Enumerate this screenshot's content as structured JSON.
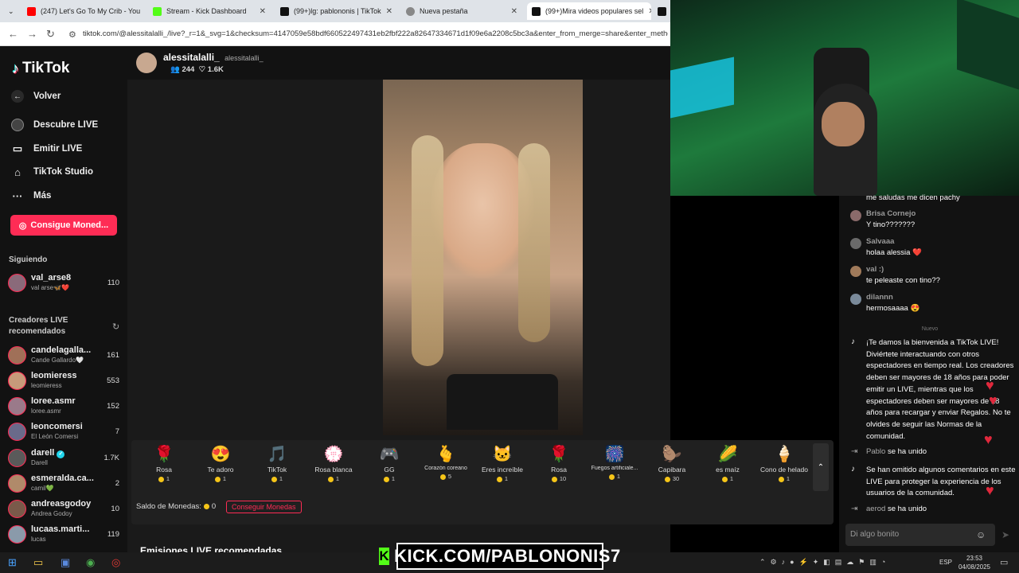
{
  "browser": {
    "tabs": [
      {
        "label": "(247) Let's Go To My Crib - You",
        "favcolor": "#ff0000"
      },
      {
        "label": "Stream - Kick Dashboard",
        "favcolor": "#53fc18"
      },
      {
        "label": "(99+)lg: pablononis | TikTok",
        "favcolor": "#111111"
      },
      {
        "label": "Nueva pestaña",
        "favcolor": "#888888"
      },
      {
        "label": "(99+)Mira videos populares sel",
        "favcolor": "#111111"
      }
    ],
    "url": "tiktok.com/@alessitalalli_/live?_r=1&_svg=1&checksum=4147059e58bdf660522497431eb2fbf222a82647334671d1f09e6a2208c5bc3a&enter_from_merge=share&enter_method=sh"
  },
  "sidebar": {
    "logo": "TikTok",
    "back_label": "Volver",
    "nav": [
      {
        "label": "Descubre LIVE",
        "icon": "live-discover-icon"
      },
      {
        "label": "Emitir LIVE",
        "icon": "broadcast-icon"
      },
      {
        "label": "TikTok Studio",
        "icon": "studio-icon"
      },
      {
        "label": "Más",
        "icon": "more-icon"
      }
    ],
    "coin_button": "Consigue Moned...",
    "following_title": "Siguiendo",
    "following": [
      {
        "name": "val_arse8",
        "sub": "val arse🦋❤️",
        "count": "110",
        "color": "#8a6a7a"
      }
    ],
    "recommended_title": "Creadores LIVE recomendados",
    "recommended": [
      {
        "name": "candelagalla...",
        "sub": "Cande Gallardo🤍",
        "count": "161",
        "color": "#a07058"
      },
      {
        "name": "leomieress",
        "sub": "leomieress",
        "count": "553",
        "color": "#c79a7a"
      },
      {
        "name": "loree.asmr",
        "sub": "loree.asmr",
        "count": "152",
        "color": "#9a7a8a"
      },
      {
        "name": "leoncomersi",
        "sub": "El León Comersi",
        "count": "7",
        "color": "#6a6a8a"
      },
      {
        "name": "darell",
        "sub": "Darell",
        "count": "1.7K",
        "color": "#5a5a5a"
      },
      {
        "name": "esmeralda.ca...",
        "sub": "camil💚",
        "count": "2",
        "color": "#b08a6a"
      },
      {
        "name": "andreasgodoy",
        "sub": "Andrea Godoy",
        "count": "10",
        "color": "#7a5a4a"
      },
      {
        "name": "lucaas.marti...",
        "sub": "lucas",
        "count": "119",
        "color": "#8a9aaa"
      }
    ]
  },
  "live": {
    "username": "alessitalalli_",
    "handle": "alessitalalli_",
    "viewers": "244",
    "likes": "1.6K"
  },
  "gifts": [
    {
      "name": "Rosa",
      "price": "1",
      "icon": "🌹"
    },
    {
      "name": "Te adoro",
      "price": "1",
      "icon": "😍"
    },
    {
      "name": "TikTok",
      "price": "1",
      "icon": "🎵"
    },
    {
      "name": "Rosa blanca",
      "price": "1",
      "icon": "💮"
    },
    {
      "name": "GG",
      "price": "1",
      "icon": "🎮"
    },
    {
      "name": "Corazón coreano",
      "price": "5",
      "icon": "🫰"
    },
    {
      "name": "Eres increíble",
      "price": "1",
      "icon": "🐱"
    },
    {
      "name": "Rosa",
      "price": "10",
      "icon": "🌹"
    },
    {
      "name": "Fuegos artificiale...",
      "price": "1",
      "icon": "🎆"
    },
    {
      "name": "Capibara",
      "price": "30",
      "icon": "🦫"
    },
    {
      "name": "es maíz",
      "price": "1",
      "icon": "🌽"
    },
    {
      "name": "Cono de helado",
      "price": "1",
      "icon": "🍦"
    }
  ],
  "balance": {
    "label": "Saldo de Monedas:",
    "value": "0",
    "button": "Conseguir Monedas"
  },
  "recommended_live_title": "Emisiones LIVE recomendadas",
  "chat": {
    "top_partial": "me saludas me dicen pachy",
    "messages": [
      {
        "name": "Brisa Cornejo",
        "text": "Y tino???????"
      },
      {
        "name": "Salvaaa",
        "text": "holaa alessia ❤️"
      },
      {
        "name": "val :)",
        "text": "te peleaste con tino??"
      },
      {
        "name": "dilannn",
        "text": "hermosaaaa 😍"
      }
    ],
    "divider": "Nuevo",
    "system_welcome": "¡Te damos la bienvenida a TikTok LIVE! Diviértete interactuando con otros espectadores en tiempo real. Los creadores deben ser mayores de 18 años para poder emitir un LIVE, mientras que los espectadores deben ser mayores de 18 años para recargar y enviar Regalos. No te olvides de seguir las Normas de la comunidad.",
    "joined1": {
      "name": "Pablo",
      "text": "se ha unido"
    },
    "system_hidden": "Se han omitido algunos comentarios en este LIVE para proteger la experiencia de los usuarios de la comunidad.",
    "joined2": {
      "name": "aerod",
      "text": "se ha unido"
    },
    "input_placeholder": "Di algo bonito"
  },
  "overlay": {
    "kick_text": "KICK.COM/PABLONONIS7"
  },
  "taskbar": {
    "lang": "ESP",
    "time": "23:53",
    "date": "04/08/2025"
  }
}
